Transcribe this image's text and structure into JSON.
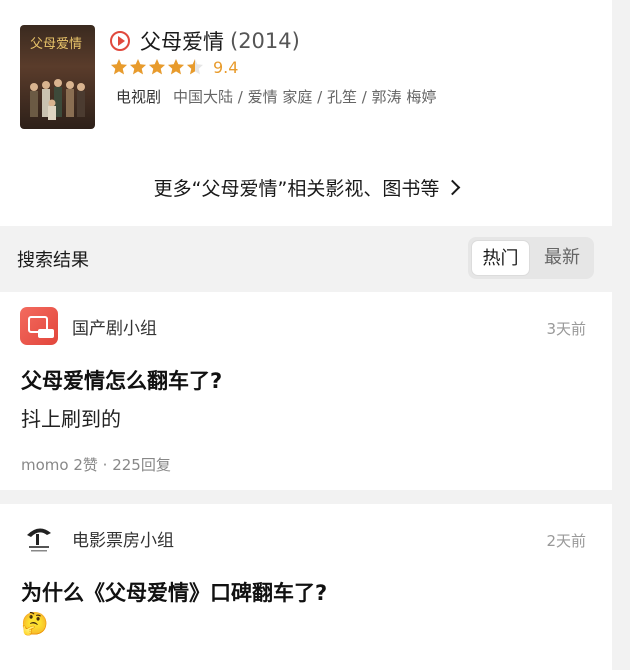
{
  "movie": {
    "poster_text": "父母爱情",
    "name": "父母爱情",
    "year": "(2014)",
    "score": "9.4",
    "rating_stars": 4.5,
    "type": "电视剧",
    "meta": "中国大陆 / 爱情 家庭 / 孔笙 / 郭涛 梅婷",
    "more_link": "更多“父母爱情”相关影视、图书等"
  },
  "results": {
    "label": "搜索结果",
    "tabs": [
      "热门",
      "最新"
    ],
    "selected_tab": "热门"
  },
  "posts": [
    {
      "group": "国产剧小组",
      "time": "3天前",
      "title": "父母爱情怎么翻车了?",
      "body": "抖上刷到的",
      "meta": "momo 2赞 · 225回复"
    },
    {
      "group": "电影票房小组",
      "time": "2天前",
      "title": "为什么《父母爱情》口碑翻车了?",
      "body": "🤔"
    }
  ],
  "colors": {
    "accent_red": "#e0493d",
    "star": "#e89b2c",
    "background_gray": "#f2f2f2"
  }
}
